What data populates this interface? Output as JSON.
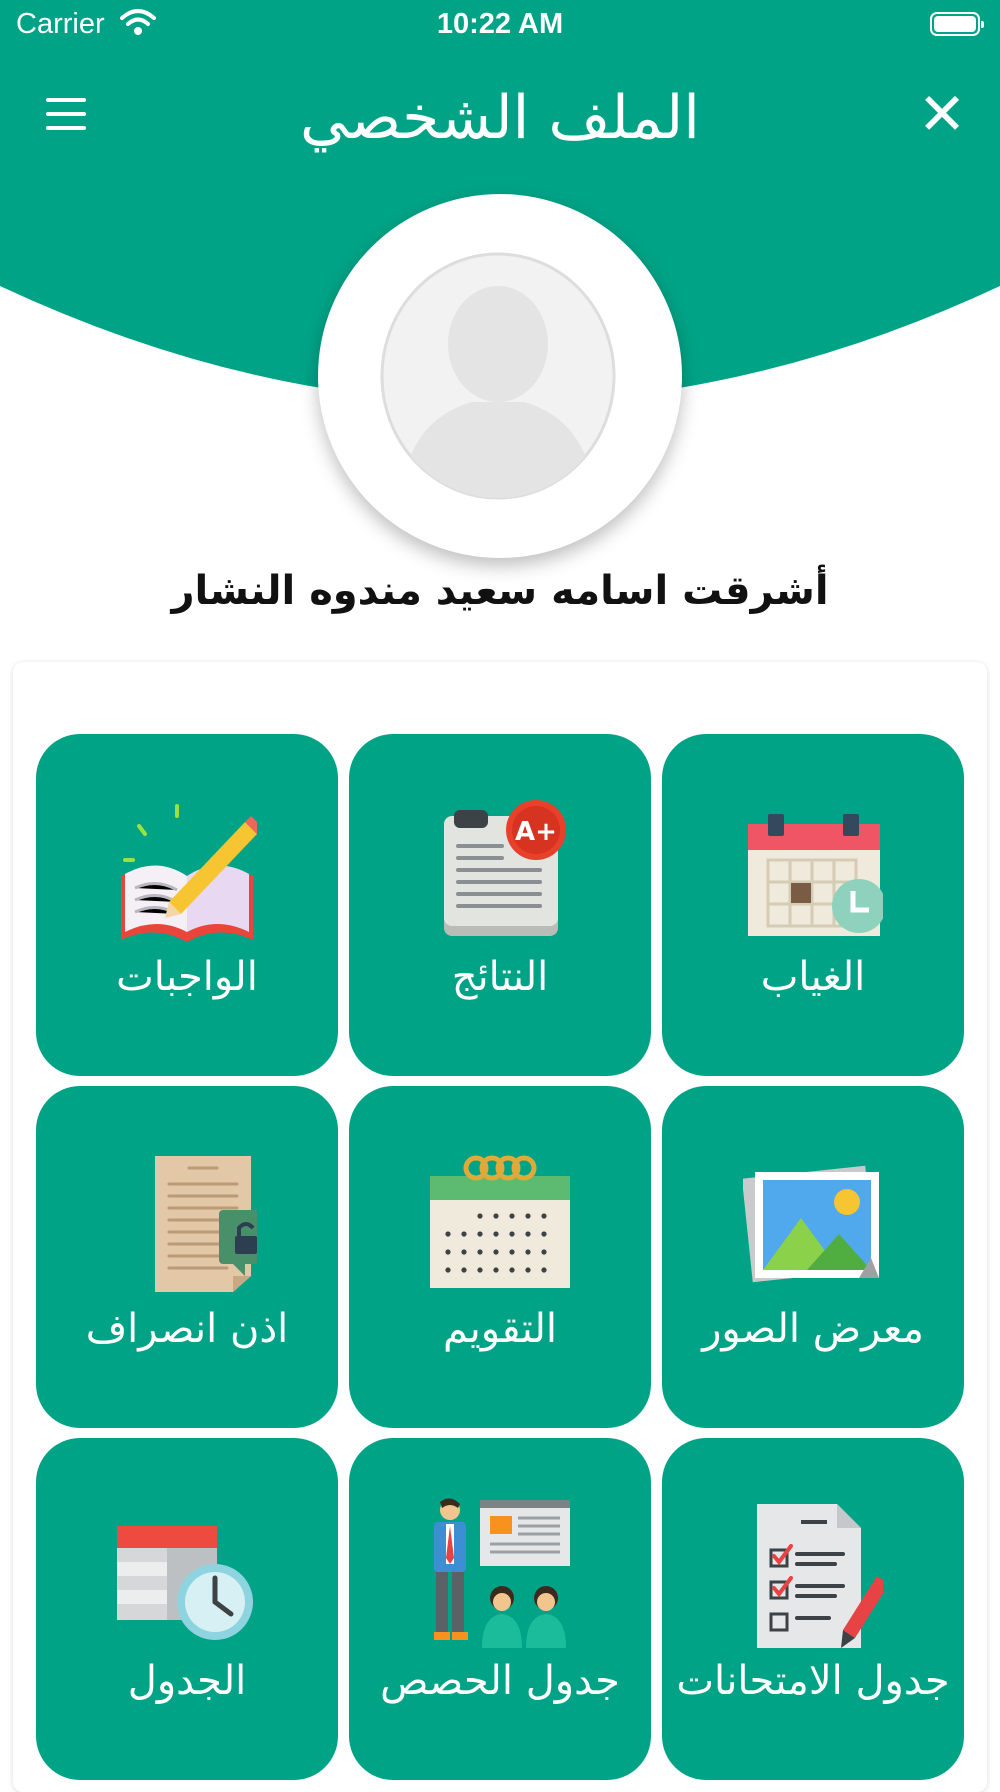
{
  "status_bar": {
    "carrier": "Carrier",
    "time": "10:22 AM"
  },
  "header": {
    "title": "الملف الشخصي",
    "close_symbol": "✕",
    "background_color": "#00a386"
  },
  "profile": {
    "name": "أشرقت اسامه سعيد مندوه النشار"
  },
  "tiles": [
    {
      "label": "الغياب",
      "icon": "absence-calendar-icon"
    },
    {
      "label": "النتائج",
      "icon": "results-report-icon"
    },
    {
      "label": "الواجبات",
      "icon": "homework-book-icon"
    },
    {
      "label": "معرض الصور",
      "icon": "photo-gallery-icon"
    },
    {
      "label": "التقويم",
      "icon": "calendar-icon"
    },
    {
      "label": "اذن انصراف",
      "icon": "leave-permission-icon"
    },
    {
      "label": "جدول الامتحانات",
      "icon": "exam-checklist-icon"
    },
    {
      "label": "جدول الحصص",
      "icon": "class-schedule-icon"
    },
    {
      "label": "الجدول",
      "icon": "timetable-clock-icon"
    }
  ],
  "colors": {
    "accent": "#00a386",
    "text_dark": "#111111"
  }
}
